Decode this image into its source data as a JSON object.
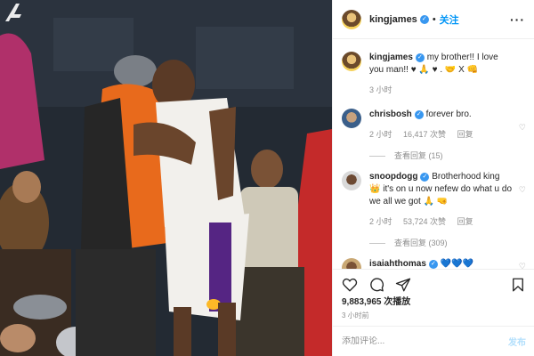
{
  "media": {
    "brand_logo_icon": "lakers-logo-icon"
  },
  "header": {
    "username": "kingjames",
    "separator": "•",
    "follow_label": "关注",
    "more_icon": "more-options-icon"
  },
  "caption": {
    "username": "kingjames",
    "text": "my brother!! I love you man!! ♥ 🙏 ♥ . 🤝 X 👊",
    "time": "3 小时"
  },
  "comments": [
    {
      "username": "chrisbosh",
      "text": "forever bro.",
      "time": "2 小时",
      "likes": "16,417 次赞",
      "reply_label": "回复",
      "view_replies": "查看回复 (15)"
    },
    {
      "username": "snoopdogg",
      "text": "Brotherhood king 👑 it's on u now nefew do what u do we all we got 🙏 🤜",
      "time": "2 小时",
      "likes": "53,724 次赞",
      "reply_label": "回复",
      "view_replies": "查看回复 (309)"
    },
    {
      "username": "isaiahthomas",
      "text": "💙💙💙"
    }
  ],
  "actions": {
    "like_icon": "heart-icon",
    "comment_icon": "comment-icon",
    "share_icon": "share-icon",
    "save_icon": "bookmark-icon"
  },
  "likes_count": "9,883,965 次播放",
  "post_time": "3 小时前",
  "add_comment": {
    "placeholder": "添加评论...",
    "publish_label": "发布"
  },
  "colors": {
    "accent": "#0095f6",
    "verified": "#3897f0",
    "muted": "#8e8e8e"
  }
}
